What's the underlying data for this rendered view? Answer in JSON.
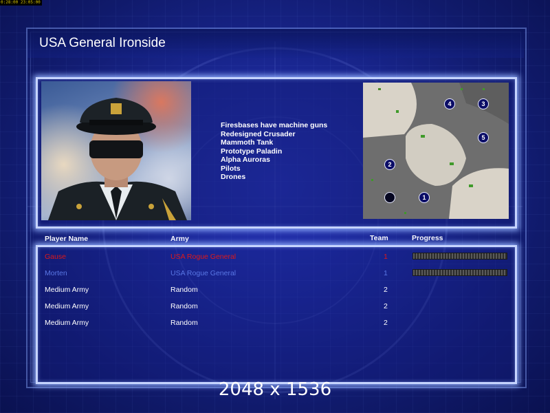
{
  "status_bar": {
    "text": "0:28:00 23:05:00"
  },
  "title": "USA General Ironside",
  "features": [
    "Firesbases have machine guns",
    "Redesigned Crusader",
    "Mammoth Tank",
    "Prototype Paladin",
    "Alpha Auroras",
    "Pilots",
    "Drones"
  ],
  "minimap": {
    "start_positions": [
      "1",
      "2",
      "3",
      "4",
      "5"
    ]
  },
  "table": {
    "headers": {
      "player_name": "Player Name",
      "army": "Army",
      "team": "Team",
      "progress": "Progress"
    },
    "rows": [
      {
        "player_name": "Gause",
        "army": "USA Rogue General",
        "team": "1",
        "color": "#e01818",
        "progress": 0
      },
      {
        "player_name": "Morten",
        "army": "USA Rogue General",
        "team": "1",
        "color": "#5a78e6",
        "progress": 0
      },
      {
        "player_name": "Medium Army",
        "army": "Random",
        "team": "2",
        "color": "#ffffff"
      },
      {
        "player_name": "Medium Army",
        "army": "Random",
        "team": "2",
        "color": "#ffffff"
      },
      {
        "player_name": "Medium Army",
        "army": "Random",
        "team": "2",
        "color": "#ffffff"
      }
    ]
  },
  "resolution_label": "2048 x 1536"
}
